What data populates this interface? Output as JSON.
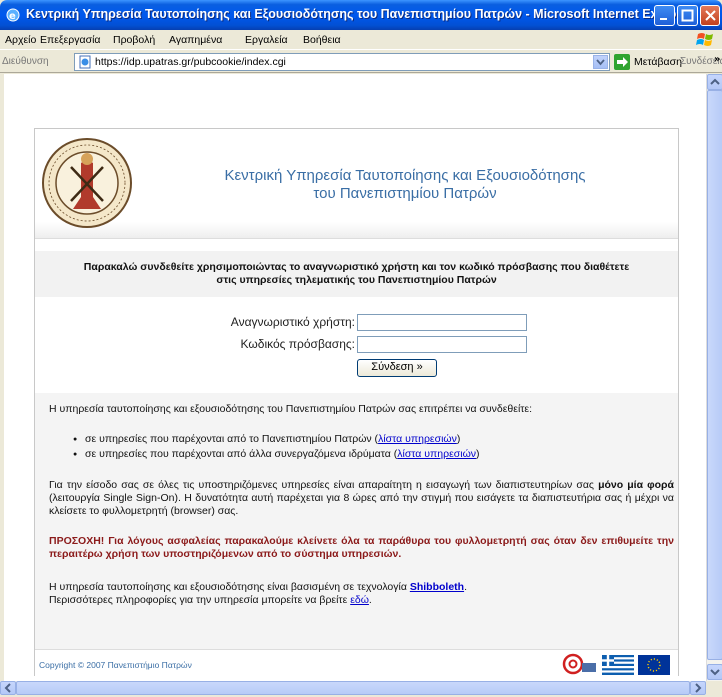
{
  "window": {
    "title": "Κεντρική Υπηρεσία Ταυτοποίησης και Εξουσιοδότησης του Πανεπιστημίου Πατρών - Microsoft Internet Explorer"
  },
  "menubar": {
    "items": [
      "Αρχείο",
      "Επεξεργασία",
      "Προβολή",
      "Αγαπημένα",
      "Εργαλεία",
      "Βοήθεια"
    ]
  },
  "addressbar": {
    "label": "Διεύθυνση",
    "url": "https://idp.upatras.gr/pubcookie/index.cgi",
    "go_label": "Μετάβαση",
    "links_label": "Συνδέσεις",
    "chevron": "»"
  },
  "header": {
    "title_line1": "Κεντρική Υπηρεσία Ταυτοποίησης και Εξουσιοδότησης",
    "title_line2": "του Πανεπιστημίου Πατρών"
  },
  "notice": {
    "line1": "Παρακαλώ συνδεθείτε χρησιμοποιώντας το αναγνωριστικό χρήστη και τον κωδικό πρόσβασης που διαθέτετε",
    "line2": "στις υπηρεσίες τηλεματικής του Πανεπιστημίου Πατρών"
  },
  "login": {
    "username_label": "Αναγνωριστικό χρήστη:",
    "username_value": "",
    "password_label": "Κωδικός πρόσβασης:",
    "password_value": "",
    "submit_label": "Σύνδεση »"
  },
  "info": {
    "intro": "Η υπηρεσία ταυτοποίησης και εξουσιοδότησης του Πανεπιστημίου Πατρών σας επιτρέπει να συνδεθείτε:",
    "bullets": [
      {
        "text": "σε υπηρεσίες που παρέχονται από το Πανεπιστημίου Πατρών (",
        "link": "λίστα υπηρεσιών",
        "after": ")"
      },
      {
        "text": "σε υπηρεσίες που παρέχονται από άλλα συνεργαζόμενα ιδρύματα (",
        "link": "λίστα υπηρεσιών",
        "after": ")"
      }
    ],
    "para2_a": "Για την είσοδο σας σε όλες τις υποστηριζόμενες υπηρεσίες είναι απαραίτητη η εισαγωγή των διαπιστευτηρίων σας ",
    "para2_bold": "μόνο μία φορά",
    "para2_b": " (λειτουργία Single Sign-On). Η δυνατότητα αυτή παρέχεται για 8 ώρες από την στιγμή που εισάγετε τα διαπιστευτήρια σας ή μέχρι να κλείσετε το φυλλομετρητή (browser) σας.",
    "warning": "ΠΡΟΣΟΧΗ! Για λόγους ασφαλείας παρακαλούμε κλείνετε όλα τα παράθυρα του φυλλομετρητή σας όταν δεν επιθυμείτε την περαιτέρω χρήση των υποστηριζόμενων από το σύστημα υπηρεσιών.",
    "para3_a": "Η υπηρεσία ταυτοποίησης και εξουσιοδότησης είναι βασισμένη σε τεχνολογία ",
    "para3_link": "Shibboleth",
    "para3_b": ".",
    "para4_a": "Περισσότερες πληροφορίες για την υπηρεσία μπορείτε να βρείτε ",
    "para4_link": "εδώ",
    "para4_b": "."
  },
  "footer": {
    "copyright": "Copyright © 2007 Πανεπιστήμιο Πατρών"
  },
  "colors": {
    "title_blue": "#3a6ea5",
    "link": "#0000cc",
    "warning": "#8b1a1a",
    "xp_titlebar": "#0058ee"
  }
}
